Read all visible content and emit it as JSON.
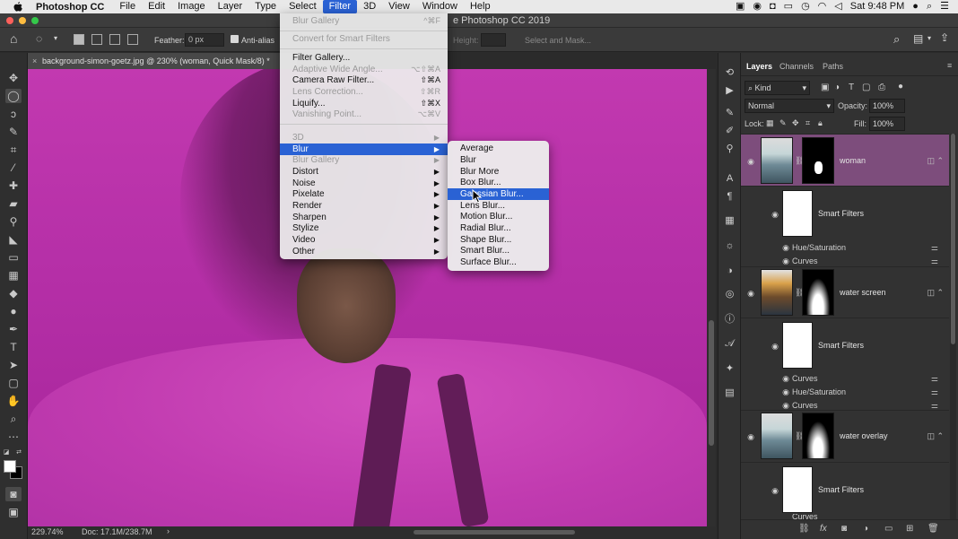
{
  "menubar": {
    "app_name": "Photoshop CC",
    "items": [
      "File",
      "Edit",
      "Image",
      "Layer",
      "Type",
      "Select",
      "Filter",
      "3D",
      "View",
      "Window",
      "Help"
    ],
    "active_item": "Filter",
    "clock": "Sat 9:48 PM"
  },
  "window": {
    "title": "e Photoshop CC 2019"
  },
  "options": {
    "feather_label": "Feather:",
    "feather_value": "0 px",
    "antialias_label": "Anti-alias",
    "height_label": "Height:",
    "select_mask_label": "Select and Mask..."
  },
  "document": {
    "tab_title": "background-simon-goetz.jpg @ 230% (woman, Quick Mask/8) *",
    "zoom": "229.74%",
    "doc_size": "Doc: 17.1M/238.7M"
  },
  "filter_menu": {
    "items": [
      {
        "label": "Blur Gallery",
        "shortcut": "^⌘F",
        "disabled": true
      },
      {
        "label": "Convert for Smart Filters",
        "disabled": true
      },
      {
        "label": "Filter Gallery...",
        "disabled": false
      },
      {
        "label": "Adaptive Wide Angle...",
        "shortcut": "⌥⇧⌘A",
        "disabled": true
      },
      {
        "label": "Camera Raw Filter...",
        "shortcut": "⇧⌘A",
        "disabled": false
      },
      {
        "label": "Lens Correction...",
        "shortcut": "⇧⌘R",
        "disabled": true
      },
      {
        "label": "Liquify...",
        "shortcut": "⇧⌘X",
        "disabled": false
      },
      {
        "label": "Vanishing Point...",
        "shortcut": "⌥⌘V",
        "disabled": true
      },
      {
        "label": "3D",
        "disabled": true,
        "submenu": true
      },
      {
        "label": "Blur",
        "disabled": false,
        "submenu": true,
        "active": true
      },
      {
        "label": "Blur Gallery",
        "disabled": true,
        "submenu": true
      },
      {
        "label": "Distort",
        "submenu": true
      },
      {
        "label": "Noise",
        "submenu": true
      },
      {
        "label": "Pixelate",
        "submenu": true
      },
      {
        "label": "Render",
        "submenu": true
      },
      {
        "label": "Sharpen",
        "submenu": true
      },
      {
        "label": "Stylize",
        "submenu": true
      },
      {
        "label": "Video",
        "submenu": true
      },
      {
        "label": "Other",
        "submenu": true
      }
    ]
  },
  "blur_menu": {
    "items": [
      "Average",
      "Blur",
      "Blur More",
      "Box Blur...",
      "Gaussian Blur...",
      "Lens Blur...",
      "Motion Blur...",
      "Radial Blur...",
      "Shape Blur...",
      "Smart Blur...",
      "Surface Blur..."
    ],
    "active_index": 4
  },
  "layers_panel": {
    "tabs": [
      "Layers",
      "Channels",
      "Paths"
    ],
    "kind_label": "Kind",
    "blend_mode": "Normal",
    "opacity_label": "Opacity:",
    "opacity_value": "100%",
    "lock_label": "Lock:",
    "fill_label": "Fill:",
    "fill_value": "100%",
    "layers": [
      {
        "name": "woman",
        "selected": true
      },
      {
        "name": "water screen",
        "selected": false
      },
      {
        "name": "water overlay",
        "selected": false
      }
    ],
    "smart_filters_label": "Smart Filters",
    "filters_group_1": [
      "Hue/Saturation",
      "Curves"
    ],
    "filters_group_2": [
      "Curves",
      "Hue/Saturation",
      "Curves"
    ],
    "filters_group_3_partial": "Curves"
  },
  "colors": {
    "accent": "#2a62d4",
    "quick_mask": "#c239b0",
    "selected_layer": "#7d4d7c"
  }
}
